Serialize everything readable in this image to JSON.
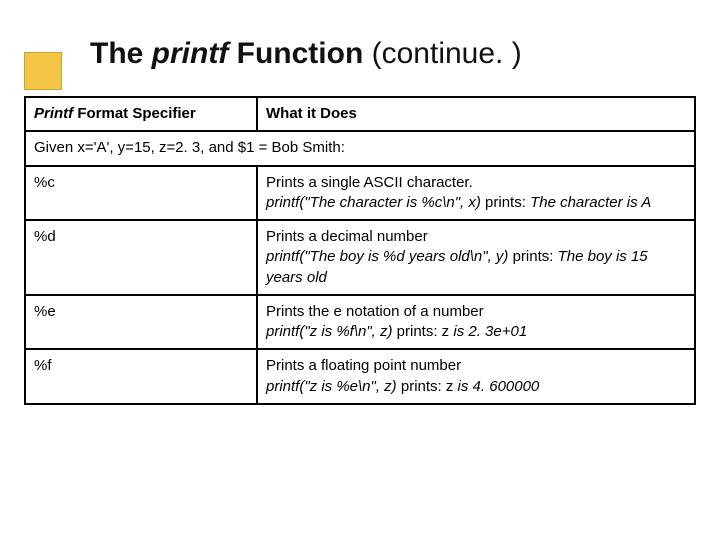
{
  "title": {
    "pre": "The ",
    "ital": "printf",
    "post": " Function",
    "cont": " (continue. )"
  },
  "table": {
    "header": {
      "col1_ital": "Printf",
      "col1_rest": " Format Specifier",
      "col2": "What it Does"
    },
    "given": "Given x='A', y=15, z=2. 3, and $1 = Bob Smith:",
    "rows": [
      {
        "spec": "%c",
        "plain": "Prints a single ASCII character.",
        "example_ital": "printf(\"The character is %c\\n\", x) ",
        "example_prints": "prints: ",
        "example_tail_ital": "The character is A"
      },
      {
        "spec": "%d",
        "plain": "Prints a decimal number",
        "example_ital": "printf(\"The boy is %d years old\\n\", y) ",
        "example_prints": "prints: ",
        "example_tail_ital": "The boy is 15 years old"
      },
      {
        "spec": "%e",
        "plain": "Prints the e notation of a  number",
        "example_ital": "printf(\"z is %f\\n\", z) ",
        "example_prints": "prints: z ",
        "example_tail_ital": "is 2. 3e+01"
      },
      {
        "spec": "%f",
        "plain": "Prints a floating point number",
        "example_ital": "printf(\"z is %e\\n\", z) ",
        "example_prints": "prints: z ",
        "example_tail_ital": "is 4. 600000"
      }
    ]
  }
}
